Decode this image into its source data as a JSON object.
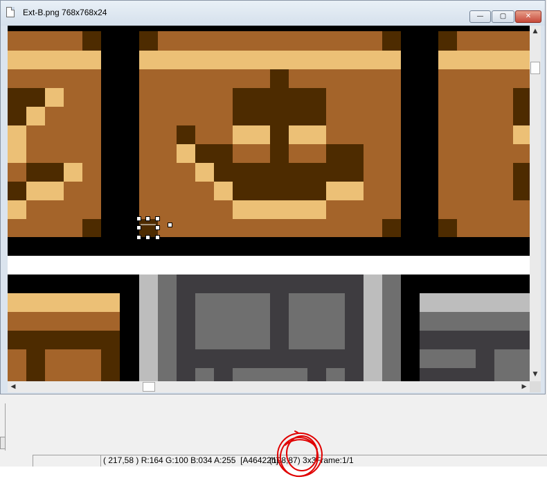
{
  "window": {
    "title": "Ext-B.png 768x768x24",
    "min_glyph": "—",
    "max_glyph": "▢",
    "close_glyph": "✕"
  },
  "scrollbars": {
    "up": "▲",
    "down": "▼",
    "left": "◀",
    "right": "▶"
  },
  "colors": {
    "tile_brown": "#a4642a",
    "tile_dark": "#4d2b00",
    "tile_light": "#ecc076",
    "black": "#000000",
    "white": "#ffffff",
    "gray_dark": "#3e3c40",
    "gray_mid": "#6f6f6f",
    "gray_light": "#bdbdbd",
    "annotation": "#e00000"
  },
  "status": {
    "cursor_info": "( 217,58 ) R:164 G:100 B:034 A:255  [A46422h]",
    "selection": "(198,87) 3x3",
    "frame": "Frame:1/1"
  }
}
